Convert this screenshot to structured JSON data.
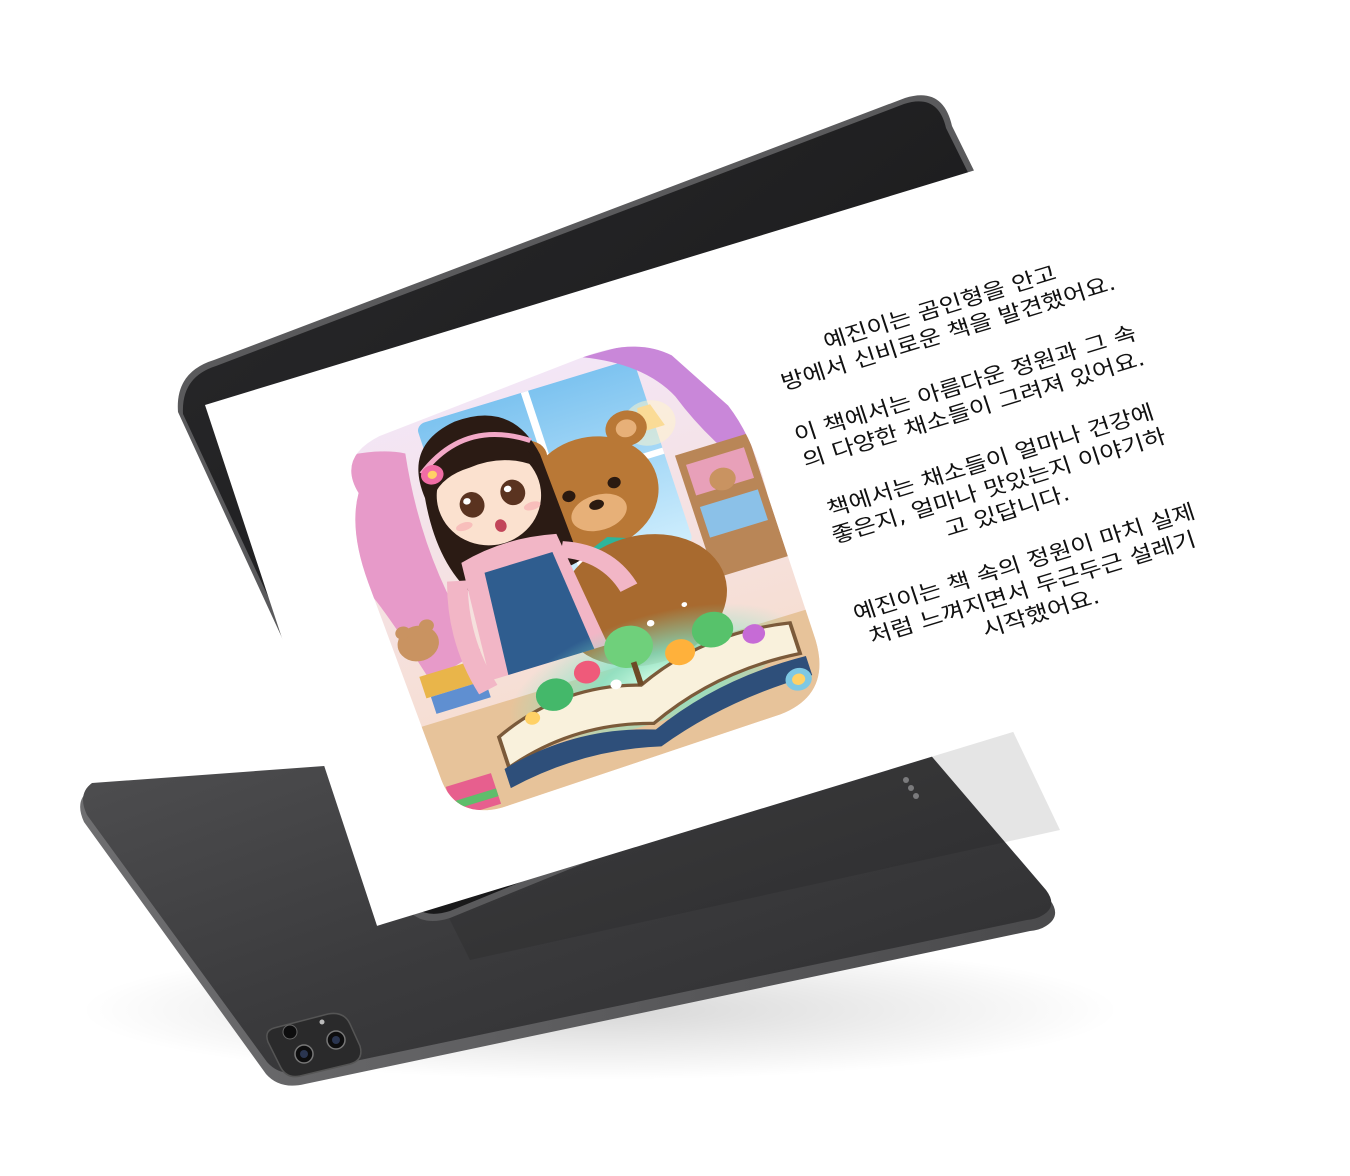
{
  "icons": {
    "camera": "rear-camera-icon",
    "connector": "smart-connector-icon",
    "front_camera": "front-camera-icon"
  },
  "colors": {
    "device_body": "#3a3a3c",
    "bezel": "#111111",
    "screen": "#ffffff",
    "text": "#111111"
  },
  "story": {
    "paragraphs": [
      {
        "lines": [
          "예진이는 곰인형을 안고",
          "방에서 신비로운 책을 발견했어요."
        ]
      },
      {
        "lines": [
          "이 책에서는 아름다운 정원과 그 속",
          "의 다양한 채소들이 그려져 있어요."
        ]
      },
      {
        "lines": [
          "책에서는 채소들이 얼마나 건강에",
          "좋은지, 얼마나 맛있는지 이야기하",
          "고 있답니다."
        ]
      },
      {
        "lines": [
          "예진이는 책 속의 정원이 마치 실제",
          "처럼 느껴지면서 두근두근 설레기",
          "시작했어요."
        ]
      }
    ]
  }
}
